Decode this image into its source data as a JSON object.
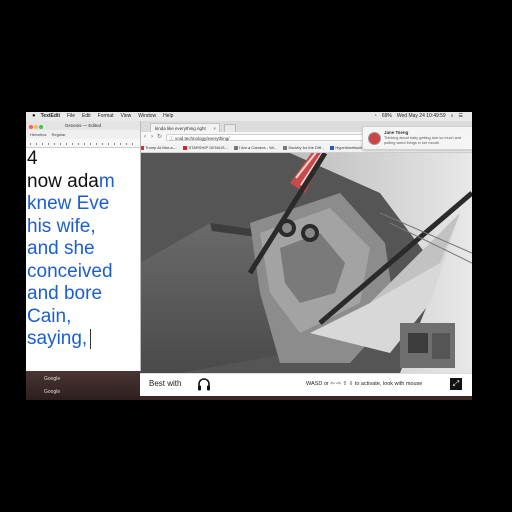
{
  "menubar": {
    "apple": "",
    "app_name": "TextEdit",
    "items": [
      "File",
      "Edit",
      "Format",
      "View",
      "Window",
      "Help"
    ],
    "datetime": "Wed May 24  10:49:59",
    "battery": "69%"
  },
  "textedit": {
    "title": "Genesis — Edited",
    "font": "Helvetica",
    "style": "Regular",
    "lines": [
      {
        "text": "4",
        "blue": ""
      },
      {
        "text": "now ada",
        "blue": "m"
      },
      {
        "text": "",
        "blue": "knew Eve"
      },
      {
        "text": "",
        "blue": "his wife,"
      },
      {
        "text": "",
        "blue": "and she"
      },
      {
        "text": "",
        "blue": "conceived"
      },
      {
        "text": "",
        "blue": "and bore"
      },
      {
        "text": "",
        "blue": "Cain,"
      },
      {
        "text": "",
        "blue": "saying,"
      }
    ]
  },
  "browser": {
    "tab_title": "kinda like everything right",
    "url": "void.technology/everything/",
    "bookmarks": [
      "Trump At Mar-a-...",
      "STARSHIP GENIUS...",
      "I Am a Camera - Wi...",
      "Society for the Diff...",
      "Hyperkinetisation...",
      "Librarything"
    ],
    "bottom": {
      "best_with": "Best with",
      "controls": "WASD or ⇦ ⇨ ⇧ ⇩ to activate, look with mouse"
    }
  },
  "notification": {
    "name": "Jane Tseng",
    "message": "Thinking about baby getting sick so much and putting weird things in her mouth"
  },
  "dock": {
    "items": [
      "Google",
      "Google"
    ]
  },
  "colors": {
    "accent_blue": "#1a5ed6",
    "viewport_gray": "#5d5d5d"
  }
}
